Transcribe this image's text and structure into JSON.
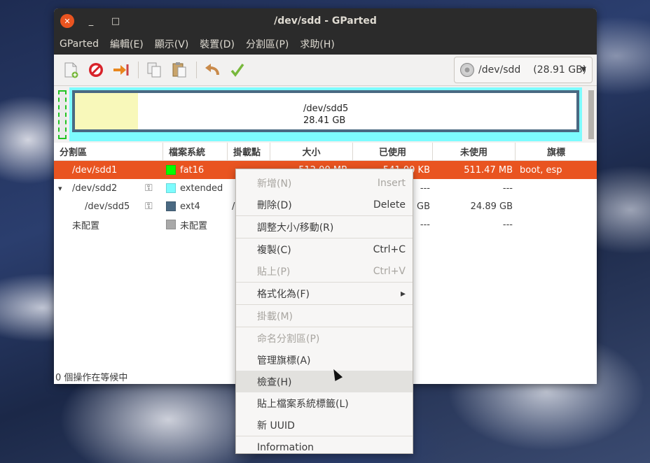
{
  "window": {
    "title": "/dev/sdd - GParted",
    "close_glyph": "✕",
    "min_glyph": "_",
    "max_glyph": "□"
  },
  "menubar": [
    "GParted",
    "編輯(E)",
    "顯示(V)",
    "裝置(D)",
    "分割區(P)",
    "求助(H)"
  ],
  "toolbar": {
    "device_name": "/dev/sdd",
    "device_size": "(28.91 GB)",
    "icons": [
      "new-partition-icon",
      "delete-icon",
      "resize-move-icon",
      "copy-icon",
      "paste-icon",
      "undo-icon",
      "apply-icon"
    ]
  },
  "diskmap": {
    "ext_name": "/dev/sdd5",
    "ext_size": "28.41 GB"
  },
  "table": {
    "headers": [
      "分割區",
      "檔案系統",
      "掛載點",
      "大小",
      "已使用",
      "未使用",
      "旗標"
    ],
    "rows": [
      {
        "name": "/dev/sdd1",
        "fs": "fat16",
        "color": "#00ff00",
        "mount": "",
        "size": "512.00 MB",
        "used": "541.00 KB",
        "unused": "511.47 MB",
        "flags": "boot, esp",
        "expander": "",
        "key": false,
        "indent": 1
      },
      {
        "name": "/dev/sdd2",
        "fs": "extended",
        "color": "#7dfcfe",
        "mount": "",
        "size": "",
        "used": "---",
        "unused": "---",
        "flags": "",
        "expander": "▾",
        "key": true,
        "indent": 1
      },
      {
        "name": "/dev/sdd5",
        "fs": "ext4",
        "color": "#4a6982",
        "mount": "/",
        "size": "",
        "used": "2 GB",
        "unused": "24.89 GB",
        "flags": "",
        "expander": "",
        "key": true,
        "indent": 2
      },
      {
        "name": "未配置",
        "fs": "未配置",
        "color": "#a9a9a9",
        "mount": "",
        "size": "",
        "used": "---",
        "unused": "---",
        "flags": "",
        "expander": "",
        "key": false,
        "indent": 1
      }
    ]
  },
  "status": "0 個操作在等候中",
  "context_menu": [
    {
      "label": "新增(N)",
      "accel": "Insert",
      "disabled": true
    },
    {
      "label": "刪除(D)",
      "accel": "Delete",
      "disabled": false
    },
    {
      "sep": true
    },
    {
      "label": "調整大小/移動(R)",
      "accel": "",
      "disabled": false
    },
    {
      "sep": true
    },
    {
      "label": "複製(C)",
      "accel": "Ctrl+C",
      "disabled": false
    },
    {
      "label": "貼上(P)",
      "accel": "Ctrl+V",
      "disabled": true
    },
    {
      "sep": true
    },
    {
      "label": "格式化為(F)",
      "accel": "▸",
      "disabled": false
    },
    {
      "sep": true
    },
    {
      "label": "掛載(M)",
      "accel": "",
      "disabled": true
    },
    {
      "sep": true
    },
    {
      "label": "命名分割區(P)",
      "accel": "",
      "disabled": true
    },
    {
      "label": "管理旗標(A)",
      "accel": "",
      "disabled": false
    },
    {
      "label": "檢查(H)",
      "accel": "",
      "disabled": false,
      "hover": true
    },
    {
      "label": "貼上檔案系統標籤(L)",
      "accel": "",
      "disabled": false
    },
    {
      "label": "新 UUID",
      "accel": "",
      "disabled": false
    },
    {
      "sep": true
    },
    {
      "label": "Information",
      "accel": "",
      "disabled": false
    }
  ]
}
